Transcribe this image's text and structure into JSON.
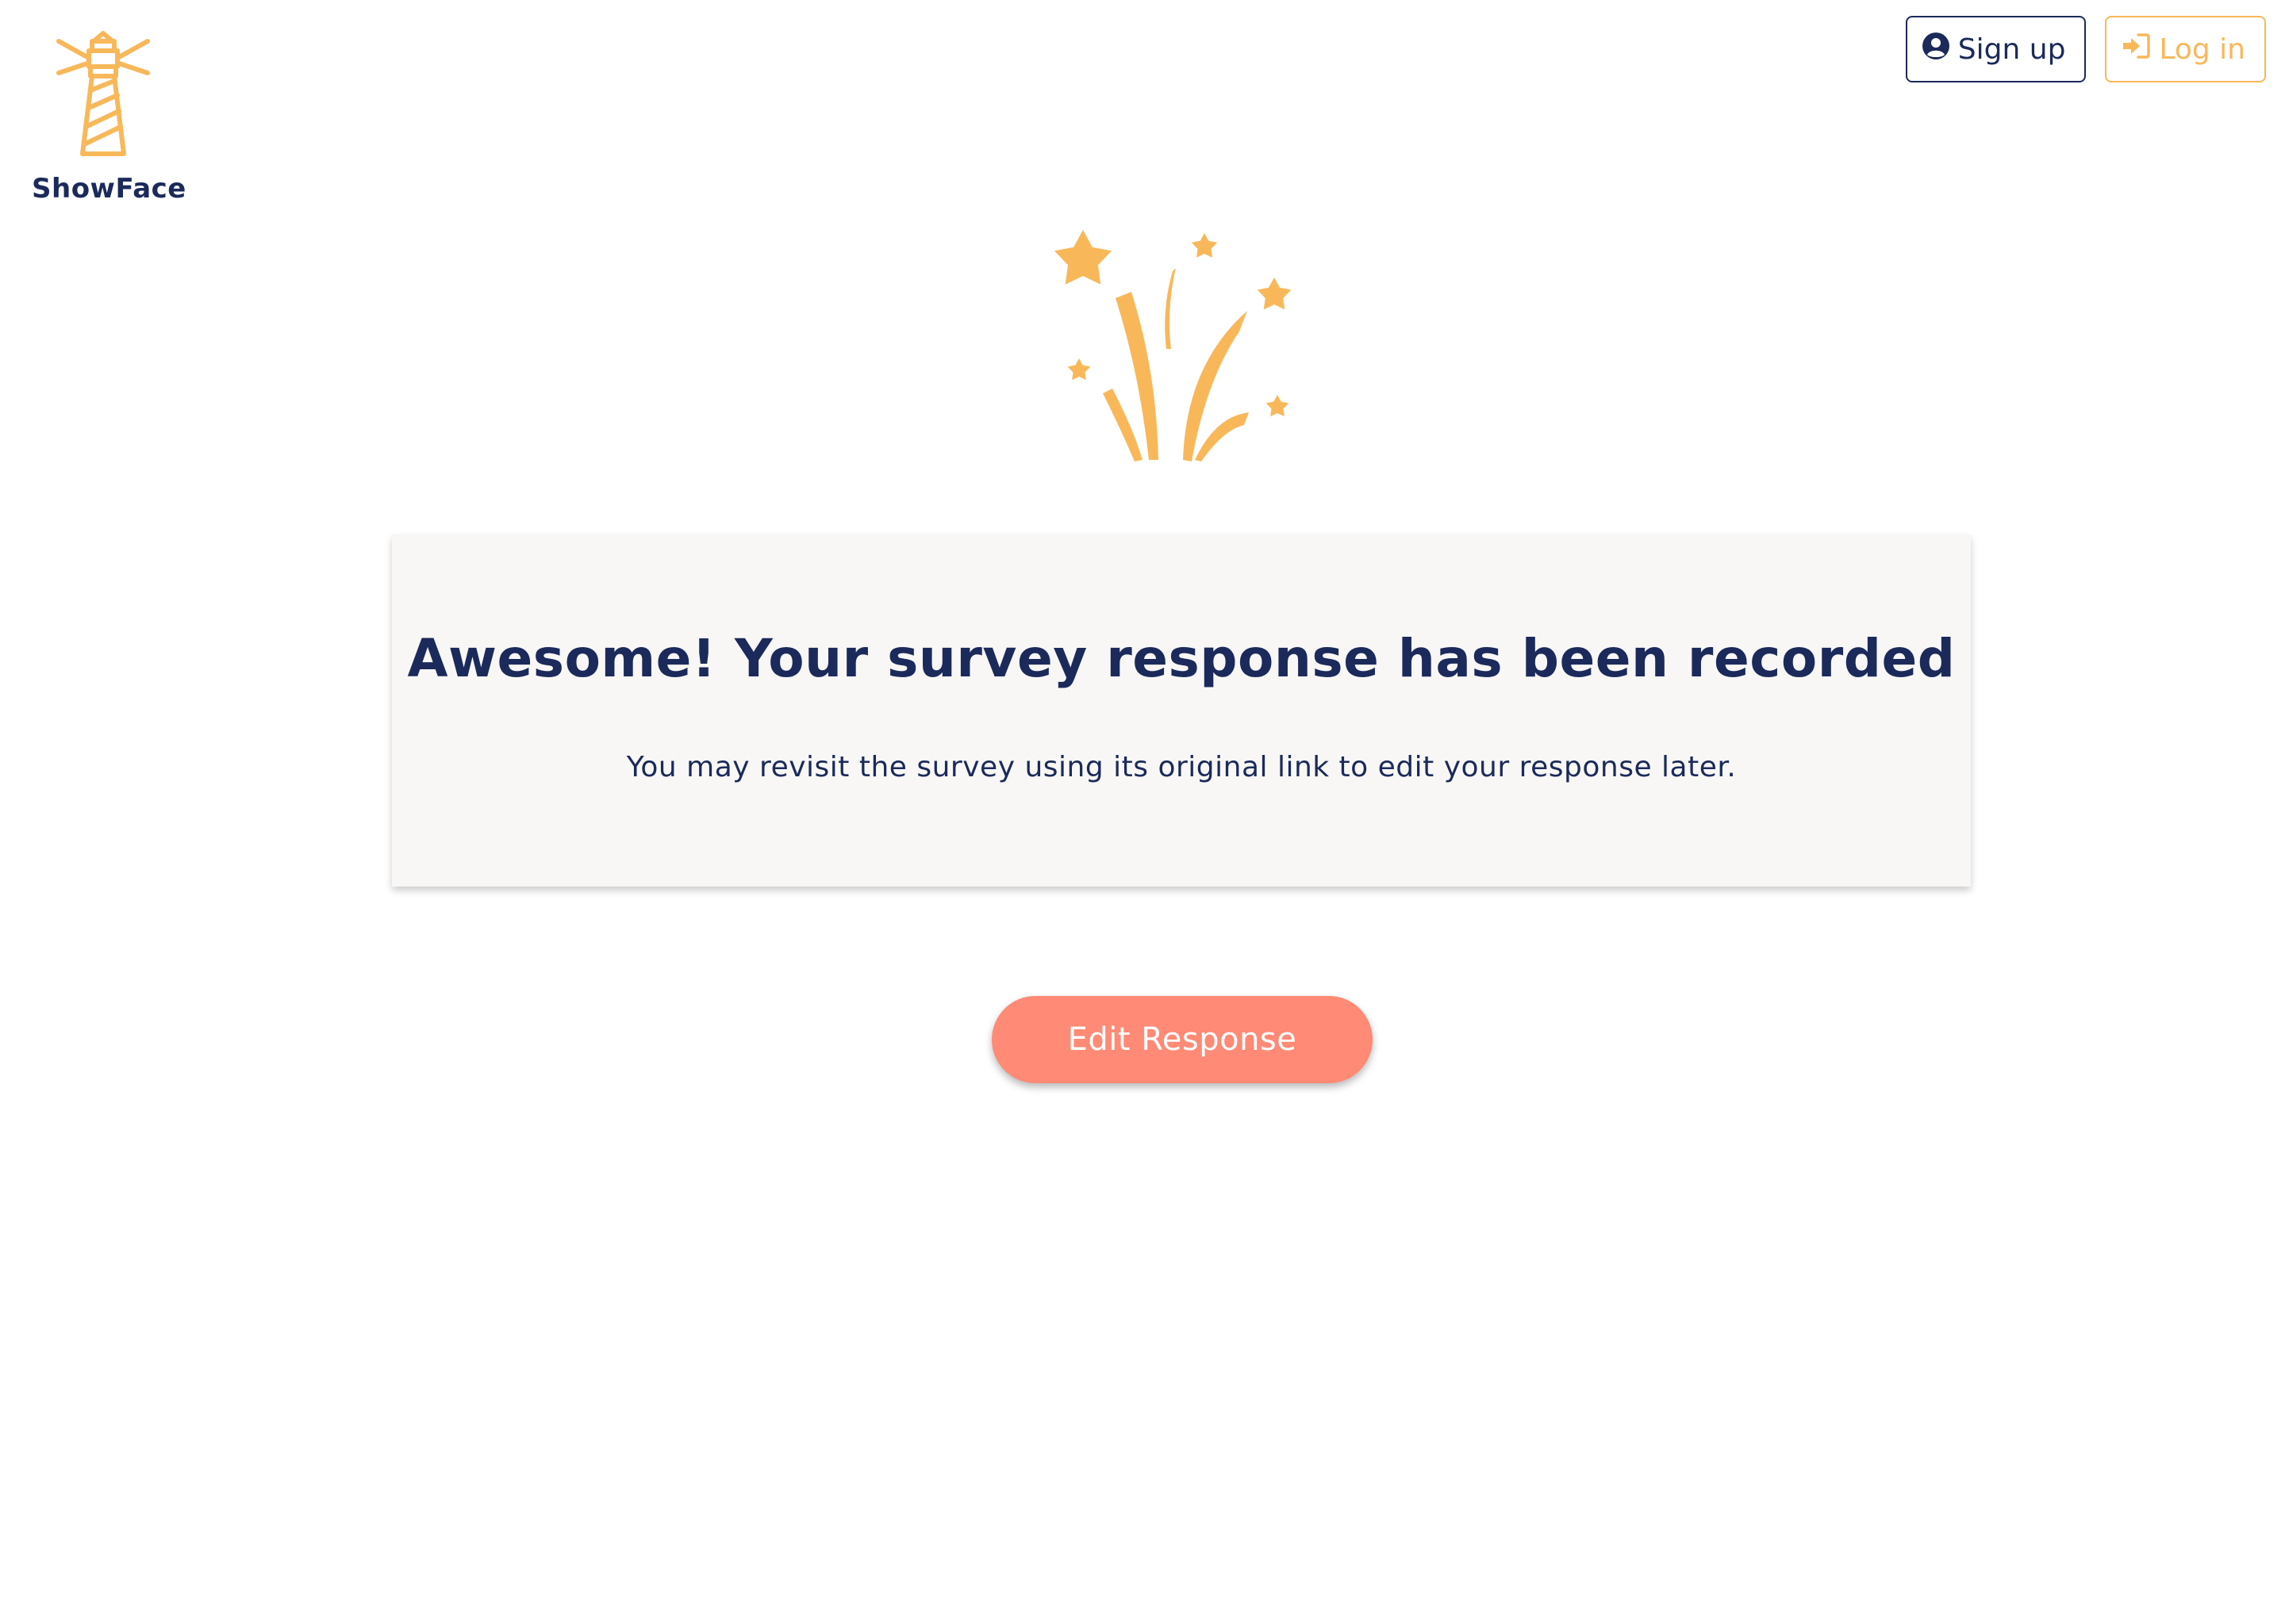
{
  "brand": {
    "name": "ShowFace",
    "logo_icon": "lighthouse-icon"
  },
  "nav": {
    "signup_label": "Sign up",
    "signup_icon": "user-circle-icon",
    "login_label": "Log in",
    "login_icon": "sign-in-icon"
  },
  "hero": {
    "icon": "fireworks-icon"
  },
  "card": {
    "title": "Awesome! Your survey response has been recorded",
    "subtitle": "You may revisit the survey using its original link to edit your response later."
  },
  "actions": {
    "edit_label": "Edit Response"
  },
  "colors": {
    "navy": "#1b2a5b",
    "accent": "#f8b85a",
    "cta": "#ff8a75",
    "card_bg": "#f8f7f5"
  }
}
